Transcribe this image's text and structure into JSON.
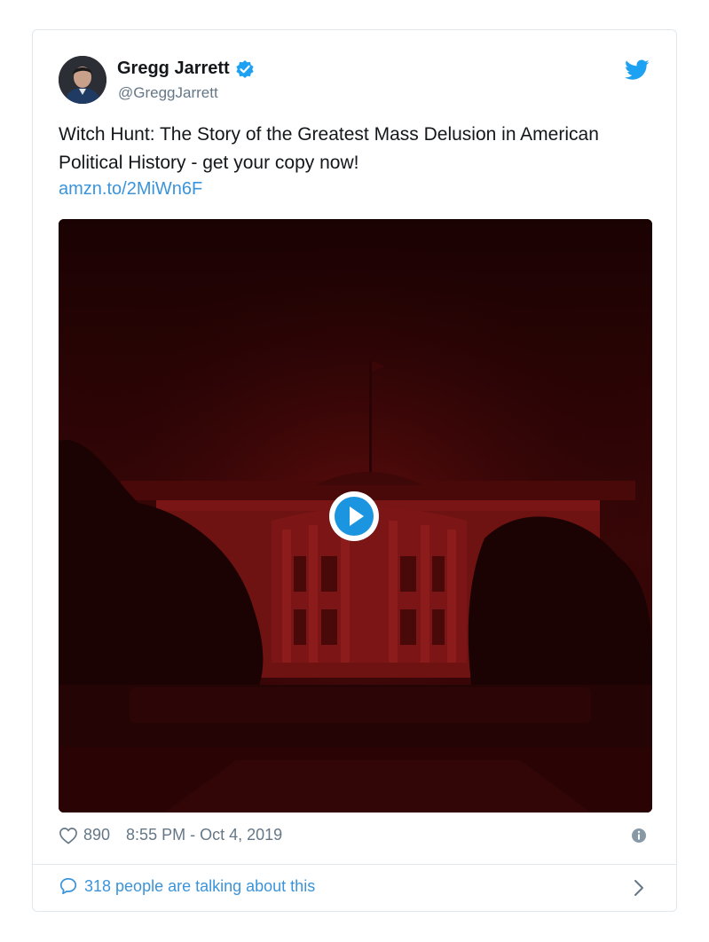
{
  "tweet": {
    "author": {
      "display_name": "Gregg Jarrett",
      "handle": "@GreggJarrett",
      "verified": true
    },
    "text": "Witch Hunt: The Story of the Greatest Mass Delusion in American Political History - get your copy now!",
    "link": "amzn.to/2MiWn6F",
    "likes": "890",
    "timestamp": "8:55 PM - Oct 4, 2019",
    "conversation": "318 people are talking about this"
  },
  "icons": {
    "verified": "verified-badge-icon",
    "platform": "twitter-bird-icon",
    "play": "play-icon",
    "like": "heart-icon",
    "info": "info-icon",
    "reply": "speech-bubble-icon",
    "more": "chevron-right-icon"
  },
  "colors": {
    "accent": "#1da1f2",
    "link": "#3b94d9",
    "secondary_text": "#657786",
    "media_tint": "#5a0a0a"
  }
}
